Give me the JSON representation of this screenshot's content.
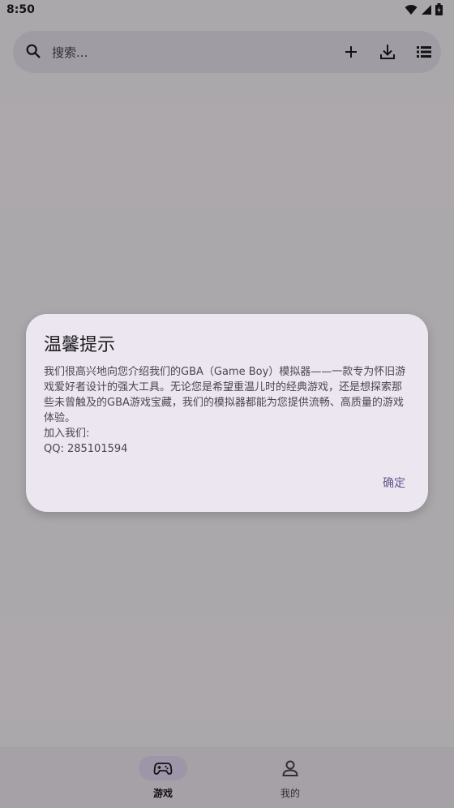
{
  "status_bar": {
    "time": "8:50",
    "icons": [
      "wifi-icon",
      "signal-icon",
      "battery-icon"
    ]
  },
  "search": {
    "placeholder": "搜索...",
    "actions": [
      "add-icon",
      "download-icon",
      "list-icon"
    ]
  },
  "bottom_nav": {
    "items": [
      {
        "label": "游戏",
        "icon": "gamepad-icon",
        "selected": true
      },
      {
        "label": "我的",
        "icon": "person-icon",
        "selected": false
      }
    ]
  },
  "dialog": {
    "title": "温馨提示",
    "paragraphs": [
      "我们很高兴地向您介绍我们的GBA（Game Boy）模拟器——一款专为怀旧游戏爱好者设计的强大工具。无论您是希望重温儿时的经典游戏，还是想探索那些未曾触及的GBA游戏宝藏，我们的模拟器都能为您提供流畅、高质量的游戏体验。",
      "加入我们:",
      "QQ: 285101594"
    ],
    "confirm_label": "确定"
  },
  "colors": {
    "accent": "#65558f",
    "surface": "#ece6f0",
    "nav_indicator": "#e8def8",
    "scrim": "rgba(0,0,0,0.32)"
  }
}
